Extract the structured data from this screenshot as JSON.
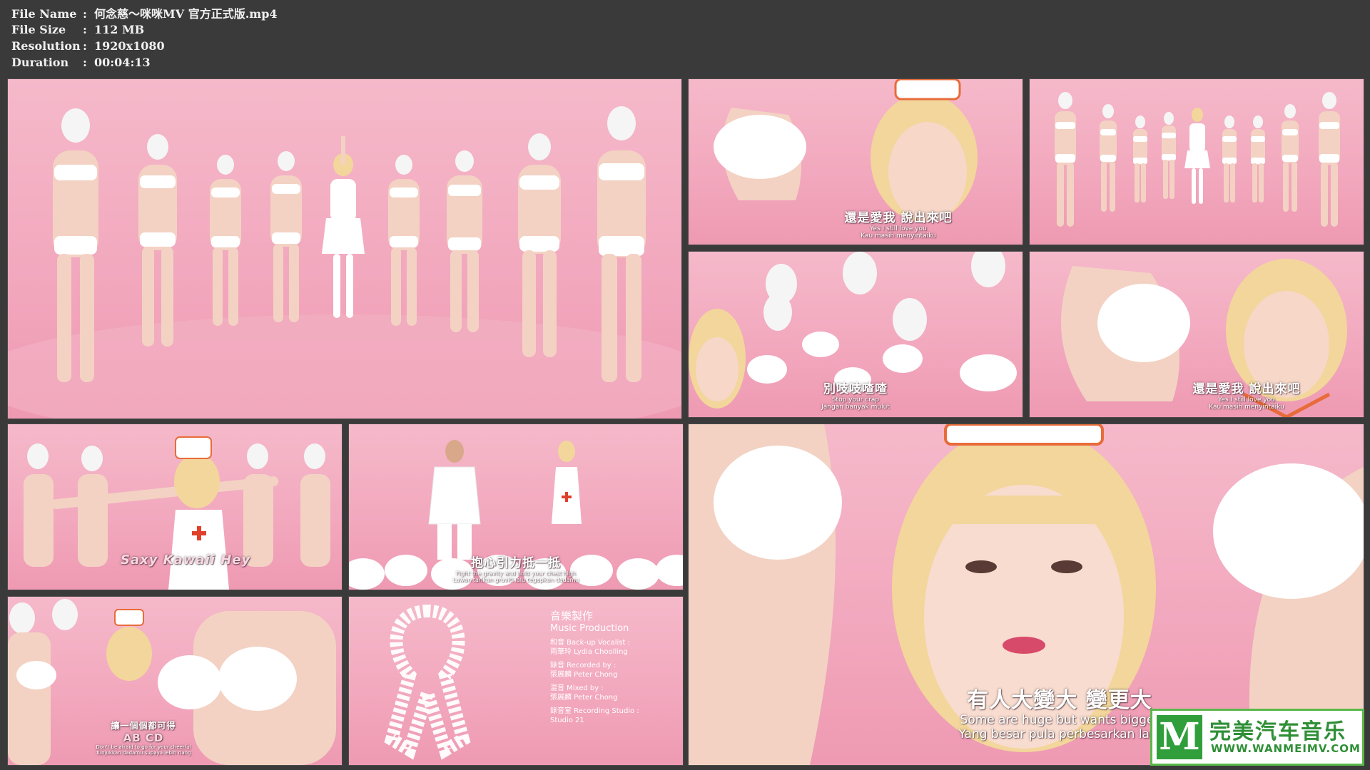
{
  "file_info": {
    "rows": [
      {
        "key": "File Name",
        "sep": ":",
        "value": "何念慈～咪咪MV 官方正式版.mp4"
      },
      {
        "key": "File Size",
        "sep": ":",
        "value": "112 MB"
      },
      {
        "key": "Resolution",
        "sep": ":",
        "value": "1920x1080"
      },
      {
        "key": "Duration",
        "sep": ":",
        "value": "00:04:13"
      }
    ]
  },
  "thumbnails": {
    "t2": {
      "zh": "還是愛我 說出來吧",
      "en": "Yes I still love you",
      "ms": "Kau masih menyintaiku"
    },
    "t4": {
      "zh": "別吱吱喳喳",
      "en": "Stop your crap",
      "ms": "Jangan banyak mulut"
    },
    "t5": {
      "zh": "還是愛我 說出來吧",
      "en": "Yes I still love you",
      "ms": "Kau masih menyintaiku"
    },
    "t6": {
      "zh": "Saxy Kawaii Hey"
    },
    "t7": {
      "zh": "抱心引力抵一抵",
      "en": "Fight the gravity and hold your chest high",
      "ms": "Lawan tarikan graviti lalu tegapkan dadamu"
    },
    "t8": {
      "zh": "讓一個個都可得",
      "en2": "AB CD",
      "en": "Don't be afraid to go for your cheerful",
      "ms": "Tunjukkan dadamu supaya lebih riang"
    },
    "t9": {
      "title_zh": "音樂製作",
      "title_en": "Music Production",
      "lines": [
        "和音 Back-up Vocalist :",
        "雨華玲 Lydia Choolling",
        "",
        "錄音 Recorded by :",
        "張展麟 Peter Chong",
        "",
        "混音 Mixed by :",
        "張展麟 Peter Chong",
        "",
        "錄音室 Recording Studio :",
        "Studio 21"
      ]
    },
    "t10": {
      "zh": "有人大變大 變更大",
      "en": "Some are huge but wants bigger",
      "ms": "Yang besar pula perbesarkan lagi"
    }
  },
  "watermark": {
    "letter": "M",
    "name": "完美汽车音乐",
    "url": "WWW.WANMEIMV.COM"
  },
  "colors": {
    "background": "#3a3a3a",
    "pink": "#f2a7bd",
    "logo_green": "#2f9e3b"
  }
}
